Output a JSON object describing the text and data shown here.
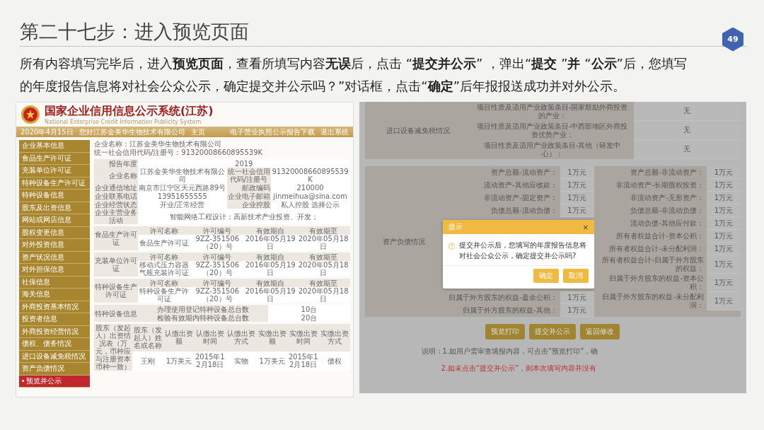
{
  "slide": {
    "title": "第二十七步：进入预览页面",
    "page_number": "49",
    "intro": "所有内容填写完毕后，进入**预览页面**，查看所填写内容**无误**后，点击 “**提交并公示**” ，弹出“**提交** ”**并** “**公示**”后，您填写的年度报告信息将对社会公众公示，确定提交并公示吗？”对话框，点击“**确定**”后年报报送成功并对外公示。"
  },
  "left_screenshot": {
    "system_title": "国家企业信用信息公示系统(江苏)",
    "system_subtitle": "National Enterprise Credit Information Publicity System",
    "header_bar": {
      "date": "2020年4月15日",
      "greeting": "您好江苏金美华生物技术有限公司",
      "home": "主页",
      "download": "电子营业执照公示报告下载",
      "logout": "退出系统"
    },
    "sidebar": {
      "items": [
        {
          "label": "企业基本信息",
          "selected": false
        },
        {
          "label": "食品生产许可证",
          "selected": false
        },
        {
          "label": "充装单位许可证",
          "selected": false
        },
        {
          "label": "特种设备生产许可证",
          "selected": false
        },
        {
          "label": "特种设备信息",
          "selected": false
        },
        {
          "label": "股东及出资信息",
          "selected": false
        },
        {
          "label": "网站或网店信息",
          "selected": false
        },
        {
          "label": "股权变更信息",
          "selected": false
        },
        {
          "label": "对外投资信息",
          "selected": false
        },
        {
          "label": "资产状况信息",
          "selected": false
        },
        {
          "label": "对外担保信息",
          "selected": false
        },
        {
          "label": "社保信息",
          "selected": false
        },
        {
          "label": "海关信息",
          "selected": false
        },
        {
          "label": "外商投资基本情况",
          "selected": false
        },
        {
          "label": "投资者信息",
          "selected": false
        },
        {
          "label": "外商投资经营情况",
          "selected": false
        },
        {
          "label": "债权、债务情况",
          "selected": false
        },
        {
          "label": "进口设备减免税情况",
          "selected": false
        },
        {
          "label": "资产负债情况",
          "selected": false
        },
        {
          "label": "预览并公示",
          "selected": true
        }
      ]
    },
    "company_line": {
      "name": "企业名称：江苏金美华生物技术有限公司",
      "code": "统一社会信用代码/注册号：91320008660895539K"
    },
    "basic_info": [
      {
        "label": "报告年度",
        "value": "2019"
      },
      {
        "label": "企业名称",
        "value": "江苏金美华生物技术有限公司",
        "label2": "统一社会信用代码/注册号",
        "value2": "91320008660895539K"
      },
      {
        "label": "企业通信地址",
        "value": "南京市江宁区天元西路89号",
        "label2": "邮政编码",
        "value2": "210000"
      },
      {
        "label": "企业联系电话",
        "value": "13951655555",
        "label2": "企业电子邮箱",
        "value2": "jinmeihua@sina.com"
      },
      {
        "label": "企业经营状态",
        "value": "开业/正常经营",
        "label2": "企业控股",
        "value2": "私人控股 选择公示"
      },
      {
        "label": "企业主营业务活动",
        "value": "智能网络工程设计；高新技术产业投资、开发；"
      }
    ],
    "licenses": [
      {
        "section": "食品生产许可证",
        "headers": [
          "许可名称",
          "许可编号",
          "有效期自",
          "有效期至"
        ],
        "row": [
          "食品生产许可证",
          "9ZZ-351506（20）号",
          "2016年05月19日",
          "2020年05月18日"
        ]
      },
      {
        "section": "充装单位许可证",
        "headers": [
          "许可名称",
          "许可编号",
          "有效期自",
          "有效期至"
        ],
        "row": [
          "移动式压力容器气瓶充装许可证",
          "9ZZ-351506（20）号",
          "2016年05月19日",
          "2020年05月18日"
        ]
      },
      {
        "section": "特种设备生产许可证",
        "headers": [
          "许可名称",
          "许可编号",
          "有效期自",
          "有效期至"
        ],
        "row": [
          "特种设备生产许可证",
          "9ZZ-351506（20）号",
          "2016年05月19日",
          "2020年05月18日"
        ]
      }
    ],
    "equipment": {
      "section": "特种设备信息",
      "rows": [
        {
          "label": "办理使用登记特种设备总台数",
          "value": "10台"
        },
        {
          "label": "检验有效期内特种设备总台数",
          "value": "20台"
        }
      ]
    },
    "shareholders": {
      "section": "股东（发起人）出资情况表（万元，币种应与注册资本币种一致）",
      "headers": [
        "股东（发起人）姓名或名称",
        "认缴出资额",
        "认缴出资时间",
        "认缴出资方式",
        "实缴出资额",
        "实缴出资时间",
        "实缴出资方式"
      ],
      "row": [
        "王刚",
        "1万美元",
        "2015年12月18日",
        "实物",
        "1万美元",
        "2015年12月18日",
        "债权"
      ]
    }
  },
  "right_screenshot": {
    "tax": {
      "section": "进口设备减免税情况",
      "rows": [
        {
          "label": "项目性质及适用产业政策条目-国家鼓励外商投资的产业：",
          "value": "无"
        },
        {
          "label": "项目性质及适用产业政策条目-中西部地区外商投资优势产业：",
          "value": "无"
        },
        {
          "label": "项目性质及适用产业政策条目-其他（研发中心）：",
          "value": "无"
        }
      ]
    },
    "balance": {
      "section": "资产负债情况",
      "left_rows": [
        {
          "label": "资产总额-流动资产：",
          "value": "1万元"
        },
        {
          "label": "流动资产-其他应收款：",
          "value": "1万元"
        },
        {
          "label": "非流动资产-固定资产：",
          "value": "1万元"
        },
        {
          "label": "负债总额-流动负债：",
          "value": "1万元"
        },
        {
          "label": "归属于外方股东的权益-盈余公积：",
          "value": "1万元"
        },
        {
          "label": "归属于外方股东的权益-其他：",
          "value": "1万元"
        }
      ],
      "right_rows": [
        {
          "label": "资产总额-非流动资产：",
          "value": "1万元"
        },
        {
          "label": "非流动资产-长期股权投资：",
          "value": "1万元"
        },
        {
          "label": "非流动资产-无形资产：",
          "value": "1万元"
        },
        {
          "label": "负债总额-非流动负债：",
          "value": "1万元"
        },
        {
          "label": "流动负债-其他应付款：",
          "value": "1万元"
        },
        {
          "label": "所有者权益合计-资本公积：",
          "value": "1万元"
        },
        {
          "label": "所有者权益合计-未分配利润：",
          "value": "1万元"
        },
        {
          "label": "所有者权益合计-归属于外方股东的权益：",
          "value": "1万元"
        },
        {
          "label": "归属于外方股东的权益-资本公积：",
          "value": "1万元"
        },
        {
          "label": "归属于外方股东的权益-未分配利润：",
          "value": "1万元"
        }
      ]
    },
    "buttons": [
      "预览打印",
      "提交并公示",
      "返回修改"
    ],
    "notes": [
      {
        "text": "说明：1.如用户需审查填报内容，可点击“预览打印”，确",
        "kind": "info"
      },
      {
        "text": "2.如未点击“提交并公示”，则本次填写内容并没有",
        "kind": "warning"
      }
    ],
    "dialog": {
      "title": "提示",
      "close": "×",
      "message": "提交并公示后，您填写的年度报告信息将对社会公众公示，确定提交并公示吗?",
      "buttons": [
        "确定",
        "取消"
      ]
    }
  }
}
